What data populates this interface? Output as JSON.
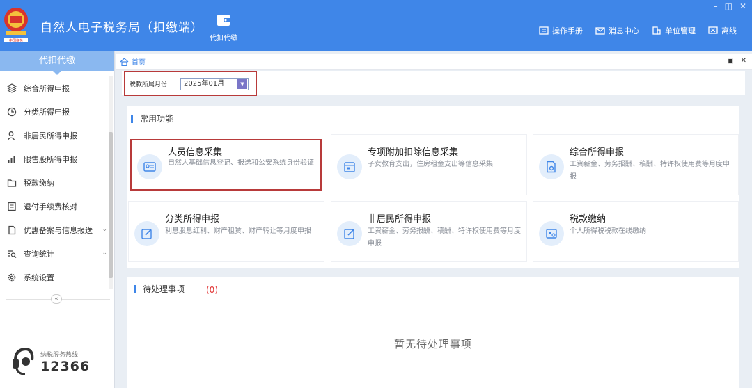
{
  "header": {
    "title": "自然人电子税务局（扣缴端）",
    "tab_label": "代扣代缴",
    "links": [
      {
        "label": "操作手册",
        "icon": "manual-icon"
      },
      {
        "label": "消息中心",
        "icon": "mail-icon"
      },
      {
        "label": "单位管理",
        "icon": "building-icon"
      },
      {
        "label": "离线",
        "icon": "offline-icon"
      }
    ],
    "window_controls": [
      "–",
      "◫",
      "✕"
    ]
  },
  "sidebar": {
    "heading": "代扣代缴",
    "items": [
      {
        "label": "综合所得申报",
        "icon": "layers-icon",
        "expand": ""
      },
      {
        "label": "分类所得申报",
        "icon": "clock-icon",
        "expand": ""
      },
      {
        "label": "非居民所得申报",
        "icon": "person-icon",
        "expand": ""
      },
      {
        "label": "限售股所得申报",
        "icon": "bar-chart-icon",
        "expand": ""
      },
      {
        "label": "税款缴纳",
        "icon": "folder-icon",
        "expand": ""
      },
      {
        "label": "退付手续费核对",
        "icon": "receipt-icon",
        "expand": ""
      },
      {
        "label": "优惠备案与信息报送",
        "icon": "document-icon",
        "expand": "⌄"
      },
      {
        "label": "查询统计",
        "icon": "query-icon",
        "expand": "⌄"
      },
      {
        "label": "系统设置",
        "icon": "gear-icon",
        "expand": ""
      }
    ],
    "collapse_symbol": "«",
    "hotline_label": "纳税服务热线",
    "hotline_number": "12366"
  },
  "breadcrumb": {
    "current": "首页",
    "icons": [
      "▣",
      "✕"
    ]
  },
  "filter": {
    "label": "税款所属月份",
    "month_value": "2025年01月",
    "drop_symbol": "▼"
  },
  "common_functions": {
    "title": "常用功能",
    "cards": [
      {
        "title": "人员信息采集",
        "desc": "自然人基础信息登记、报送和公安系统身份验证",
        "icon": "id-card-icon"
      },
      {
        "title": "专项附加扣除信息采集",
        "desc": "子女教育支出，住房租金支出等信息采集",
        "icon": "calendar-icon"
      },
      {
        "title": "综合所得申报",
        "desc": "工资薪金、劳务报酬、稿酬、特许权使用费等月度申报",
        "icon": "doc-gear-icon"
      },
      {
        "title": "分类所得申报",
        "desc": "利息股息红利、财产租赁、财产转让等月度申报",
        "icon": "edit-icon"
      },
      {
        "title": "非居民所得申报",
        "desc": "工资薪金、劳务报酬、稿酬、特许权使用费等月度申报",
        "icon": "edit-icon"
      },
      {
        "title": "税款缴纳",
        "desc": "个人所得税税款在线缴纳",
        "icon": "payment-icon"
      }
    ]
  },
  "pending": {
    "title": "待处理事项",
    "count": "(0)",
    "empty": "暂无待处理事项"
  },
  "colors": {
    "header_blue": "#3f86e8",
    "sidebar_head": "#8ab8f0",
    "highlight_red": "#b83a3a",
    "count_red": "#e03030"
  }
}
